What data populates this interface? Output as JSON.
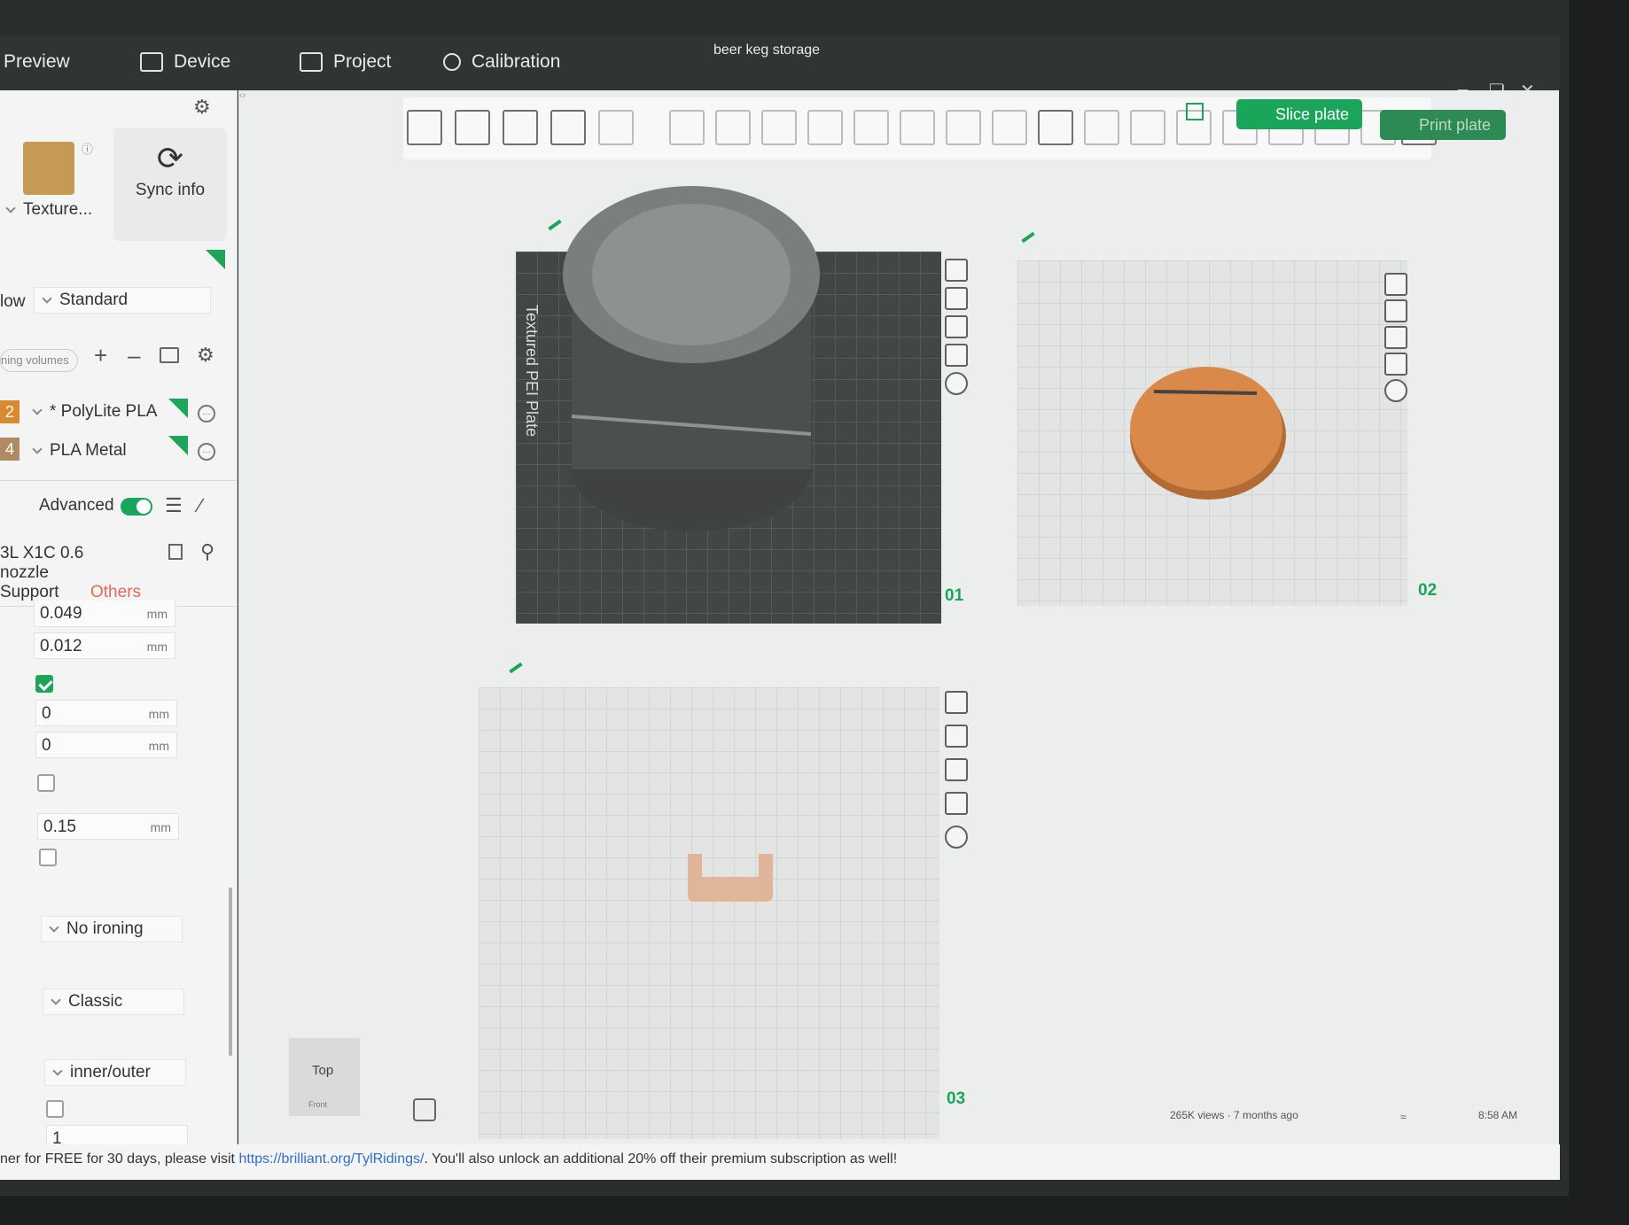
{
  "window": {
    "title": "beer keg storage"
  },
  "tabs": [
    {
      "label": "Preview",
      "icon": "preview-icon"
    },
    {
      "label": "Device",
      "icon": "device-icon"
    },
    {
      "label": "Project",
      "icon": "project-icon"
    },
    {
      "label": "Calibration",
      "icon": "calibration-icon"
    }
  ],
  "left_panel": {
    "texture_label": "Texture...",
    "sync_label": "Sync info",
    "flow_label": "low",
    "flow_value": "Standard",
    "volumes_label": "ning volumes",
    "filaments": [
      {
        "index": "2",
        "name": "* PolyLite PLA",
        "color": "#d9892f"
      },
      {
        "index": "4",
        "name": "PLA Metal",
        "color": "#b08a62"
      }
    ],
    "advanced_label": "Advanced",
    "printer": "3L X1C 0.6 nozzle",
    "subtabs": {
      "support": "Support",
      "others": "Others"
    },
    "values": {
      "v1": "0.049",
      "v2": "0.012",
      "v3": "0",
      "v4": "0",
      "v5": "0.15",
      "v6": "1"
    },
    "unit": "mm",
    "ironing": "No ironing",
    "mode": "Classic",
    "wall_order": "inner/outer"
  },
  "canvas": {
    "slice_label": "Slice plate",
    "print_label": "Print plate",
    "plates": [
      "01",
      "02",
      "03"
    ],
    "plate_text": "Textured PEI Plate",
    "view_cube": {
      "top": "Top",
      "front": "Front"
    }
  },
  "status_bar": {
    "text_a": "ner for FREE for 30 days, please visit ",
    "link": "https://brilliant.org/TylRidings/",
    "text_b": ". You'll also unlock an additional 20% off their premium subscription as well!",
    "views": "265K views · 7 months ago",
    "clock": "8:58 AM"
  },
  "colors": {
    "accent": "#1aa55a",
    "keg": "#5a5d5c",
    "lid": "#d98a4a"
  }
}
